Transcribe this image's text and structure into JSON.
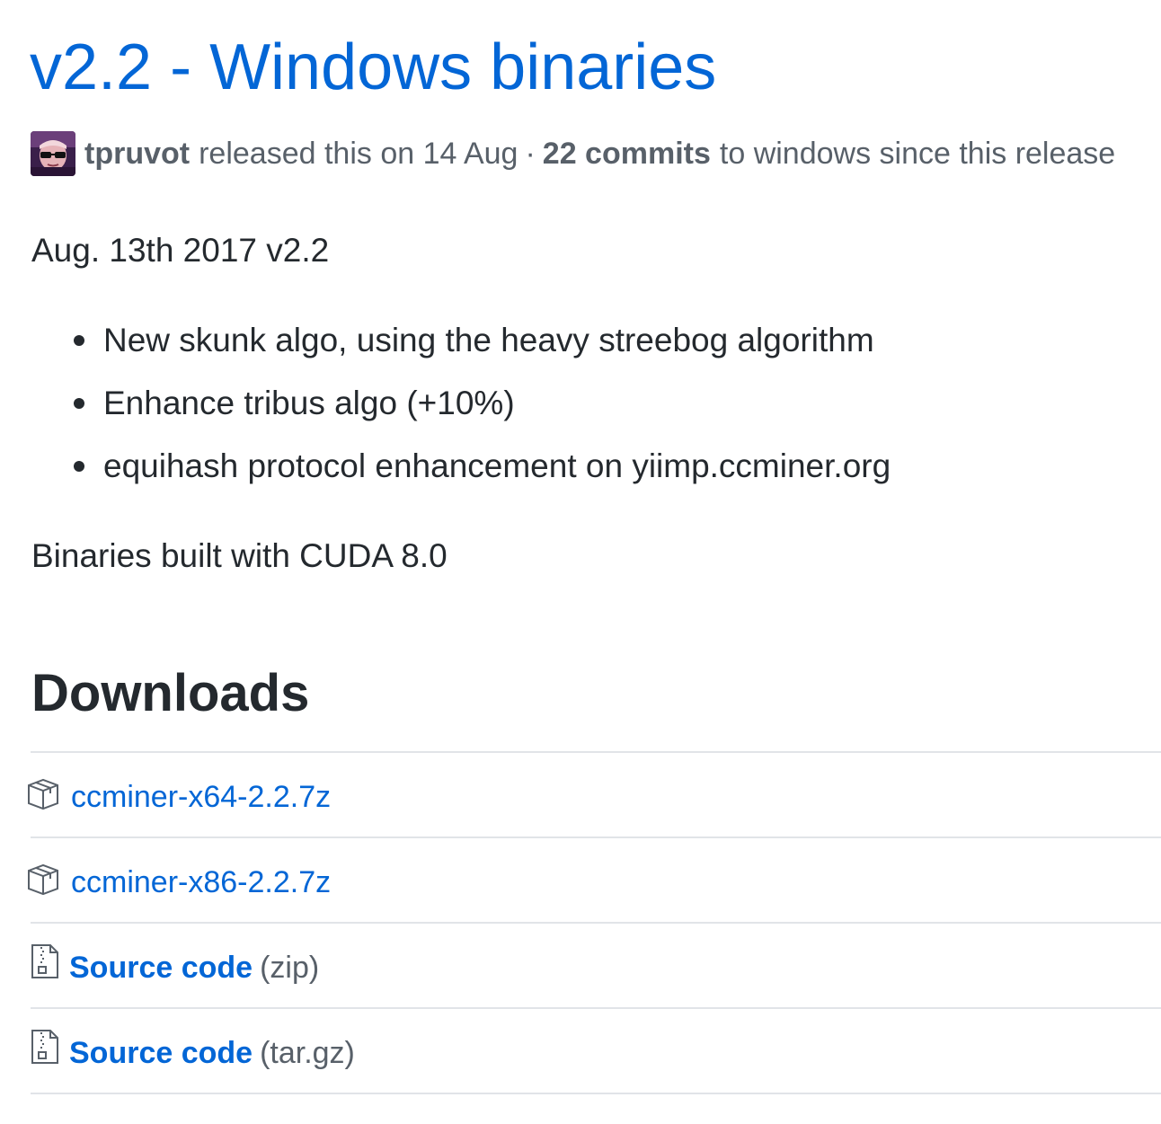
{
  "release": {
    "title": "v2.2 - Windows binaries",
    "author": "tpruvot",
    "released_text": "released this on 14 Aug",
    "separator": "·",
    "commits": "22 commits",
    "commits_suffix": "to windows since this release"
  },
  "body": {
    "date_line": "Aug. 13th 2017 v2.2",
    "notes": [
      "New skunk algo, using the heavy streebog algorithm",
      "Enhance tribus algo (+10%)",
      "equihash protocol enhancement on yiimp.ccminer.org"
    ],
    "binaries_line": "Binaries built with CUDA 8.0"
  },
  "downloads": {
    "heading": "Downloads",
    "items": [
      {
        "label": "ccminer-x64-2.2.7z",
        "icon": "package-icon"
      },
      {
        "label": "ccminer-x86-2.2.7z",
        "icon": "package-icon"
      },
      {
        "label": "Source code",
        "format": "(zip)",
        "icon": "file-zip-icon"
      },
      {
        "label": "Source code",
        "format": "(tar.gz)",
        "icon": "file-zip-icon"
      }
    ]
  },
  "colors": {
    "link": "#0366d6",
    "text": "#24292e",
    "muted": "#586069",
    "divider": "#e1e4e8"
  }
}
